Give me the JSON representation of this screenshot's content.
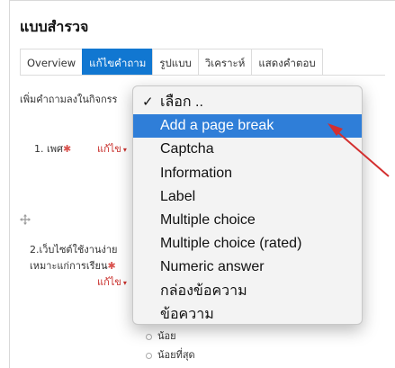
{
  "page_title": "แบบสำรวจ",
  "tabs": [
    {
      "label": "Overview",
      "active": false
    },
    {
      "label": "แก้ไขคำถาม",
      "active": true
    },
    {
      "label": "รูปแบบ",
      "active": false
    },
    {
      "label": "วิเคราะห์",
      "active": false
    },
    {
      "label": "แสดงคำตอบ",
      "active": false
    }
  ],
  "instruction": "เพิ่มคำถามลงในกิจกรร",
  "questions": [
    {
      "label": "1. เพศ",
      "required_mark": "✱",
      "edit_label": "แก้ไข"
    },
    {
      "label_line1": "2.เว็บไซต์ใช้งานง่าย",
      "label_line2": "เหมาะแก่การเรียน",
      "required_mark": "✱",
      "edit_label": "แก้ไข"
    }
  ],
  "radio_options": [
    "น้อย",
    "น้อยที่สุด"
  ],
  "dropdown": {
    "selected_check": "✓",
    "items": [
      {
        "label": "เลือก ..",
        "selected": true,
        "highlighted": false
      },
      {
        "label": "Add a page break",
        "selected": false,
        "highlighted": true
      },
      {
        "label": "Captcha",
        "selected": false,
        "highlighted": false
      },
      {
        "label": "Information",
        "selected": false,
        "highlighted": false
      },
      {
        "label": "Label",
        "selected": false,
        "highlighted": false
      },
      {
        "label": "Multiple choice",
        "selected": false,
        "highlighted": false
      },
      {
        "label": "Multiple choice (rated)",
        "selected": false,
        "highlighted": false
      },
      {
        "label": "Numeric answer",
        "selected": false,
        "highlighted": false
      },
      {
        "label": "กล่องข้อความ",
        "selected": false,
        "highlighted": false
      },
      {
        "label": "ข้อความ",
        "selected": false,
        "highlighted": false
      }
    ]
  },
  "colors": {
    "accent": "#1177d1",
    "highlight": "#2f7ed8",
    "required": "#d9534f",
    "arrow": "#d32f2f"
  }
}
